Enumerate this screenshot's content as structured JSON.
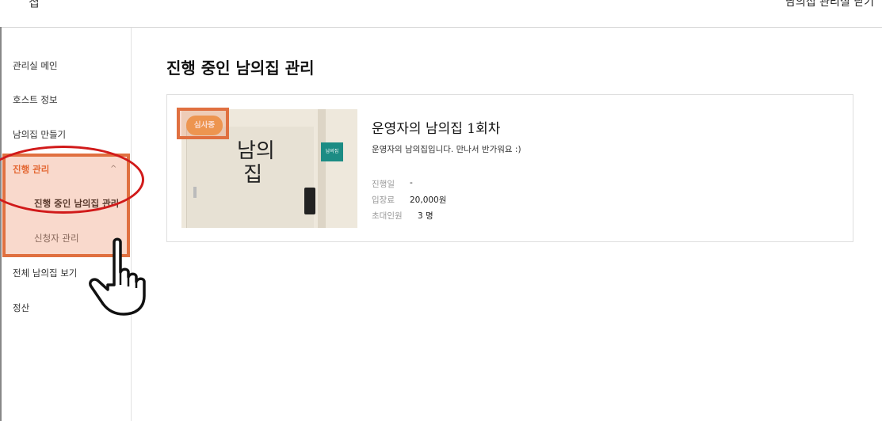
{
  "header": {
    "logo_text": "집",
    "right_link": "남의집 관리실 닫기"
  },
  "sidebar": {
    "items": [
      {
        "label": "관리실 메인"
      },
      {
        "label": "호스트 정보"
      },
      {
        "label": "남의집 만들기"
      },
      {
        "label": "진행 관리",
        "expanded": true,
        "active": true
      },
      {
        "label": "전체 남의집 보기"
      },
      {
        "label": "정산"
      }
    ],
    "sub_items": [
      {
        "label": "진행 중인 남의집 관리",
        "current": true
      },
      {
        "label": "신청자 관리"
      }
    ],
    "chevron_icon": "chevron-up-icon"
  },
  "main": {
    "title": "진행 중인 남의집 관리",
    "card": {
      "badge": "심사중",
      "thumb_title": "남의\n집",
      "thumb_sign": "남의집",
      "title": "운영자의 남의집 1회차",
      "description": "운영자의 남의집입니다. 만나서 반가워요 :)",
      "meta": [
        {
          "label": "진행일",
          "value": "-"
        },
        {
          "label": "입장료",
          "value": "20,000원"
        },
        {
          "label": "초대인원",
          "value": "3 명"
        }
      ]
    }
  },
  "colors": {
    "accent": "#e0571c",
    "highlight_border": "#e07040",
    "annotation_red": "#d11a1a",
    "badge": "#ed9a48"
  },
  "annotations": {
    "hand_icon": "pointing-hand-icon"
  }
}
